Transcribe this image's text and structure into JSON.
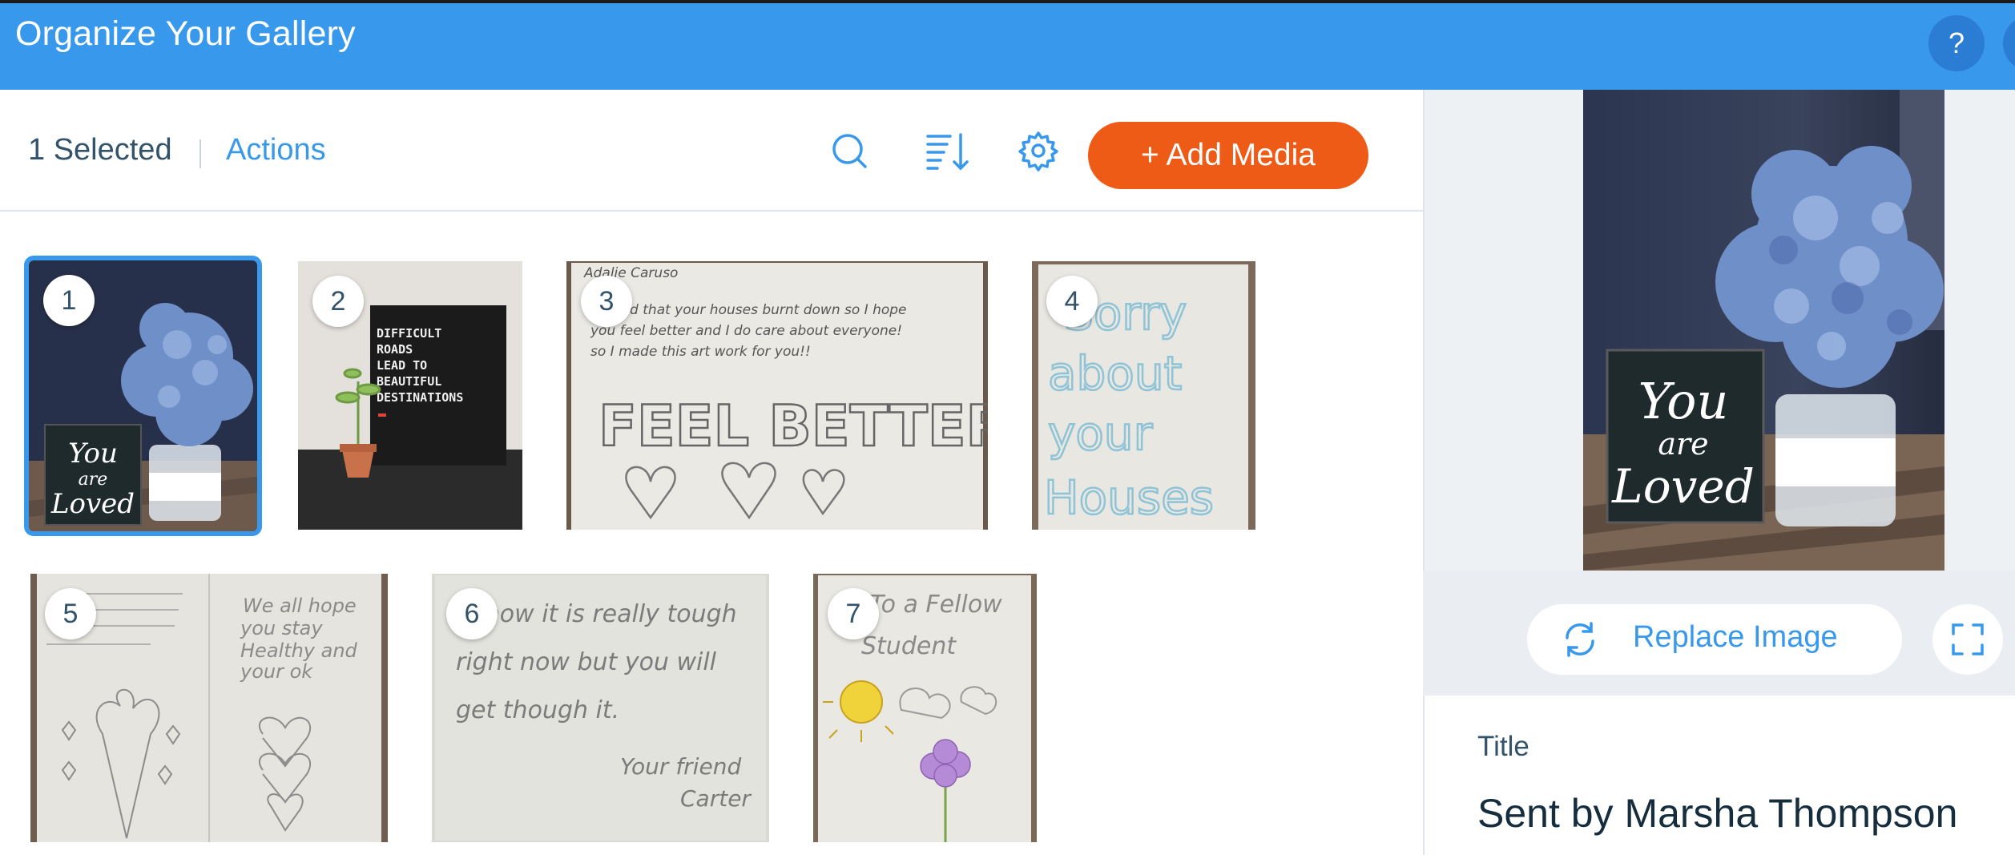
{
  "header": {
    "title": "Organize Your Gallery",
    "help_label": "?"
  },
  "toolbar": {
    "selected_count": "1 Selected",
    "actions_label": "Actions",
    "add_media_label": "+ Add Media"
  },
  "gallery": {
    "items": [
      {
        "number": "1",
        "selected": true
      },
      {
        "number": "2",
        "selected": false
      },
      {
        "number": "3",
        "selected": false
      },
      {
        "number": "4",
        "selected": false
      },
      {
        "number": "5",
        "selected": false
      },
      {
        "number": "6",
        "selected": false
      },
      {
        "number": "7",
        "selected": false
      }
    ],
    "photo_texts": {
      "sign_2": [
        "DIFFICULT",
        "ROADS",
        "LEAD TO",
        "BEAUTIFUL",
        "DESTINATIONS"
      ],
      "card_3_header": "Adalie Caruso",
      "card_3_lines": [
        "I heard that your houses burnt down so I hope",
        "you feel better and I do care about everyone!",
        "so I made this art work for you!!"
      ],
      "card_3_big": "FEEL BETTER",
      "card_4_lines": [
        "Sorry",
        "about",
        "your",
        "Houses"
      ],
      "card_5_right": [
        "We all hope",
        "you stay",
        "Healthy and",
        "your ok"
      ],
      "card_6_lines": [
        "I know it is really tough",
        "right now but you will",
        "get though it.",
        "Your friend",
        "Carter"
      ],
      "card_7_lines": [
        "To a Fellow",
        "Student"
      ],
      "sign_1": [
        "You",
        "are",
        "Loved"
      ]
    }
  },
  "side_panel": {
    "replace_label": "Replace Image",
    "title_label": "Title",
    "title_value": "Sent by Marsha Thompson"
  },
  "colors": {
    "header": "#3899ec",
    "accent": "#3899ec",
    "add_media": "#ee5b17",
    "text": "#32536a"
  }
}
